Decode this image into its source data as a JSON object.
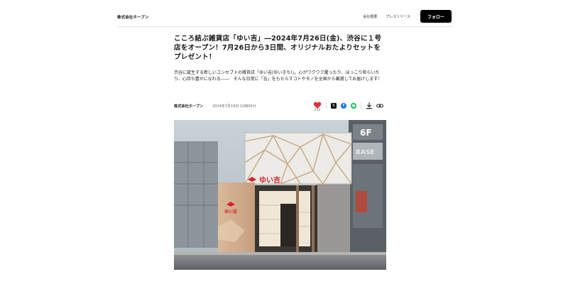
{
  "header": {
    "brand": "株式会社ホープン",
    "nav": [
      "会社概要",
      "プレスリリース"
    ],
    "follow_label": "フォロー"
  },
  "article": {
    "title": "こころ結ぶ雑貨店「ゆい吉」―2024年7月26日(金)、渋谷に１号店をオープン！7月26日から3日間、オリジナルおたよりセットをプレゼント！",
    "lead": "渋谷に誕生する新しいコンセプトの雑貨店「ゆい吉(ゆいきち)」。心がワクワク躍ったり、ほっこり和らいだり、心持ち豊かになれる――　そんな日常に「吉」をもたらすコトやモノを全国から厳選してお届けします！",
    "company": "株式会社ホープン",
    "date": "2024年7月19日 11時00分"
  },
  "actions": {
    "like_count": "212",
    "share_icons": [
      "x-icon",
      "facebook-icon",
      "line-icon"
    ],
    "tool_icons": [
      "download-icon",
      "link-icon"
    ]
  },
  "hero": {
    "shop_sign": "ゆい吉",
    "building_sign": "6F",
    "building_sign_2": "BASE"
  },
  "colors": {
    "heart": "#e0303a",
    "follow_bg": "#000000",
    "facebook": "#1877f2",
    "line": "#06c755"
  }
}
